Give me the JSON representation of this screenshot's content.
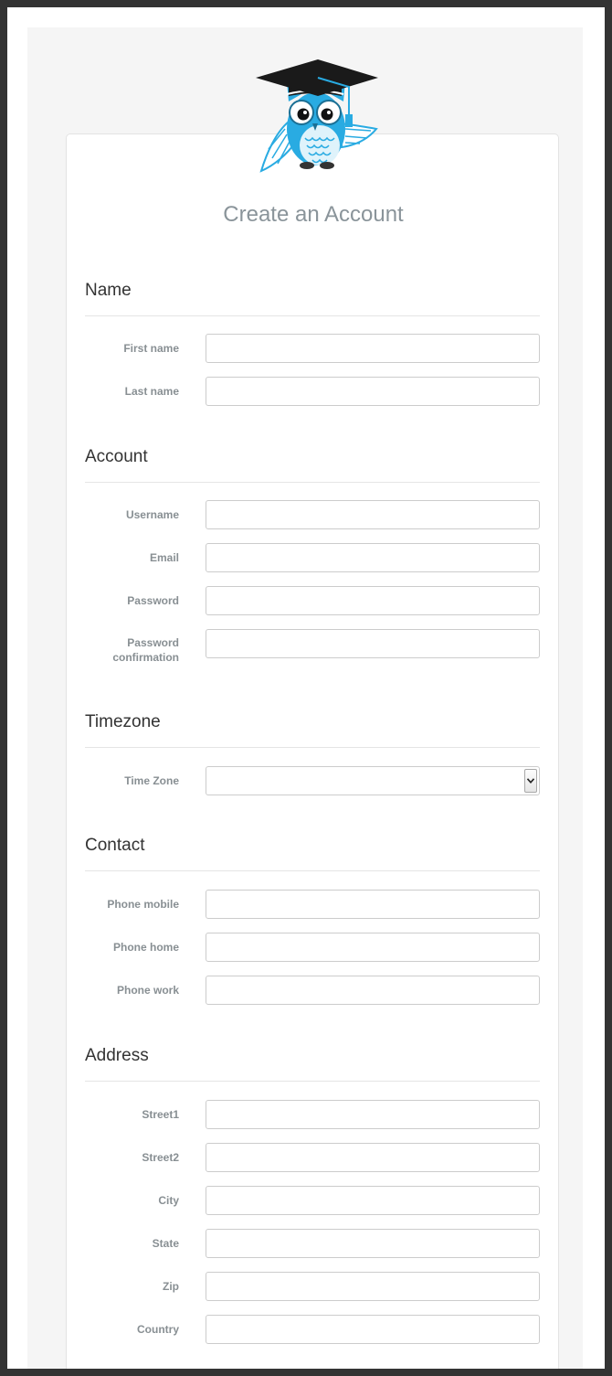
{
  "page": {
    "title": "Create an Account"
  },
  "colors": {
    "frame": "#333333",
    "background": "#f5f5f5",
    "card": "#ffffff",
    "owl_body": "#29abe2",
    "cap": "#1a1a1a"
  },
  "sections": {
    "name": {
      "title": "Name",
      "first_name": {
        "label": "First name",
        "value": "",
        "placeholder": ""
      },
      "last_name": {
        "label": "Last name",
        "value": "",
        "placeholder": ""
      }
    },
    "account": {
      "title": "Account",
      "username": {
        "label": "Username",
        "value": "",
        "placeholder": ""
      },
      "email": {
        "label": "Email",
        "value": "",
        "placeholder": ""
      },
      "password": {
        "label": "Password",
        "value": "",
        "placeholder": ""
      },
      "password_confirmation": {
        "label_line1": "Password",
        "label_line2": "confirmation",
        "value": "",
        "placeholder": ""
      }
    },
    "timezone": {
      "title": "Timezone",
      "time_zone": {
        "label": "Time Zone",
        "selected": ""
      }
    },
    "contact": {
      "title": "Contact",
      "phone_mobile": {
        "label": "Phone mobile",
        "value": "",
        "placeholder": ""
      },
      "phone_home": {
        "label": "Phone home",
        "value": "",
        "placeholder": ""
      },
      "phone_work": {
        "label": "Phone work",
        "value": "",
        "placeholder": ""
      }
    },
    "address": {
      "title": "Address",
      "street1": {
        "label": "Street1",
        "value": "",
        "placeholder": ""
      },
      "street2": {
        "label": "Street2",
        "value": "",
        "placeholder": ""
      },
      "city": {
        "label": "City",
        "value": "",
        "placeholder": ""
      },
      "state": {
        "label": "State",
        "value": "",
        "placeholder": ""
      },
      "zip": {
        "label": "Zip",
        "value": "",
        "placeholder": ""
      },
      "country": {
        "label": "Country",
        "value": "",
        "placeholder": ""
      }
    }
  },
  "icons": {
    "logo": "graduation-owl-icon",
    "select_arrow": "chevron-down-icon"
  }
}
